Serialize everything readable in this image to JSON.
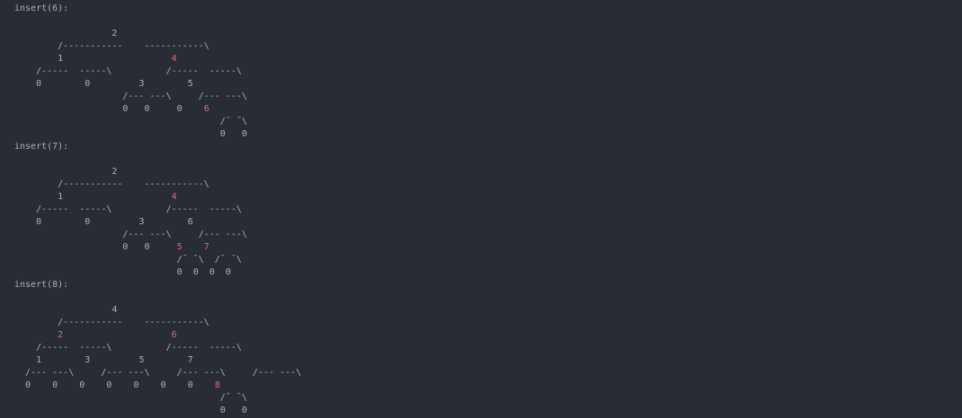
{
  "colors": {
    "background": "#282c34",
    "black_node": "#abb2bf",
    "red_node": "#e06c75",
    "edge": "#abb2bf"
  },
  "blocks": [
    {
      "header": "insert(6):",
      "rows": [
        [
          [
            "",
            "black"
          ]
        ],
        [
          [
            "                  ",
            "black"
          ],
          [
            "2",
            "black"
          ]
        ],
        [
          [
            "        /-----------    -----------\\",
            "edge"
          ]
        ],
        [
          [
            "        ",
            "black"
          ],
          [
            "1",
            "black"
          ],
          [
            "                    ",
            "black"
          ],
          [
            "4",
            "red"
          ]
        ],
        [
          [
            "    /-----  -----\\          /-----  -----\\",
            "edge"
          ]
        ],
        [
          [
            "    ",
            "black"
          ],
          [
            "0",
            "black"
          ],
          [
            "        ",
            "black"
          ],
          [
            "0",
            "black"
          ],
          [
            "         ",
            "black"
          ],
          [
            "3",
            "black"
          ],
          [
            "        ",
            "black"
          ],
          [
            "5",
            "black"
          ]
        ],
        [
          [
            "                    /--- ---\\     /--- ---\\",
            "edge"
          ]
        ],
        [
          [
            "                    ",
            "black"
          ],
          [
            "0",
            "black"
          ],
          [
            "   ",
            "black"
          ],
          [
            "0",
            "black"
          ],
          [
            "     ",
            "black"
          ],
          [
            "0",
            "black"
          ],
          [
            "    ",
            "black"
          ],
          [
            "6",
            "red"
          ]
        ],
        [
          [
            "                                      /¯ ¯\\",
            "edge"
          ]
        ],
        [
          [
            "                                      ",
            "black"
          ],
          [
            "0",
            "black"
          ],
          [
            "   ",
            "black"
          ],
          [
            "0",
            "black"
          ]
        ]
      ]
    },
    {
      "header": "insert(7):",
      "rows": [
        [
          [
            "",
            "black"
          ]
        ],
        [
          [
            "                  ",
            "black"
          ],
          [
            "2",
            "black"
          ]
        ],
        [
          [
            "        /-----------    -----------\\",
            "edge"
          ]
        ],
        [
          [
            "        ",
            "black"
          ],
          [
            "1",
            "black"
          ],
          [
            "                    ",
            "black"
          ],
          [
            "4",
            "red"
          ]
        ],
        [
          [
            "    /-----  -----\\          /-----  -----\\",
            "edge"
          ]
        ],
        [
          [
            "    ",
            "black"
          ],
          [
            "0",
            "black"
          ],
          [
            "        ",
            "black"
          ],
          [
            "0",
            "black"
          ],
          [
            "         ",
            "black"
          ],
          [
            "3",
            "black"
          ],
          [
            "        ",
            "black"
          ],
          [
            "6",
            "black"
          ]
        ],
        [
          [
            "                    /--- ---\\     /--- ---\\",
            "edge"
          ]
        ],
        [
          [
            "                    ",
            "black"
          ],
          [
            "0",
            "black"
          ],
          [
            "   ",
            "black"
          ],
          [
            "0",
            "black"
          ],
          [
            "     ",
            "black"
          ],
          [
            "5",
            "red"
          ],
          [
            "    ",
            "black"
          ],
          [
            "7",
            "red"
          ]
        ],
        [
          [
            "                              /¯ ¯\\  /¯ ¯\\",
            "edge"
          ]
        ],
        [
          [
            "                              ",
            "black"
          ],
          [
            "0",
            "black"
          ],
          [
            "  ",
            "black"
          ],
          [
            "0",
            "black"
          ],
          [
            "  ",
            "black"
          ],
          [
            "0",
            "black"
          ],
          [
            "  ",
            "black"
          ],
          [
            "0",
            "black"
          ]
        ]
      ]
    },
    {
      "header": "insert(8):",
      "rows": [
        [
          [
            "",
            "black"
          ]
        ],
        [
          [
            "                  ",
            "black"
          ],
          [
            "4",
            "black"
          ]
        ],
        [
          [
            "        /-----------    -----------\\",
            "edge"
          ]
        ],
        [
          [
            "        ",
            "black"
          ],
          [
            "2",
            "red"
          ],
          [
            "                    ",
            "black"
          ],
          [
            "6",
            "red"
          ]
        ],
        [
          [
            "    /-----  -----\\          /-----  -----\\",
            "edge"
          ]
        ],
        [
          [
            "    ",
            "black"
          ],
          [
            "1",
            "black"
          ],
          [
            "        ",
            "black"
          ],
          [
            "3",
            "black"
          ],
          [
            "         ",
            "black"
          ],
          [
            "5",
            "black"
          ],
          [
            "        ",
            "black"
          ],
          [
            "7",
            "black"
          ]
        ],
        [
          [
            "  /--- ---\\     /--- ---\\     /--- ---\\     /--- ---\\",
            "edge"
          ]
        ],
        [
          [
            "  ",
            "black"
          ],
          [
            "0",
            "black"
          ],
          [
            "    ",
            "black"
          ],
          [
            "0",
            "black"
          ],
          [
            "    ",
            "black"
          ],
          [
            "0",
            "black"
          ],
          [
            "    ",
            "black"
          ],
          [
            "0",
            "black"
          ],
          [
            "    ",
            "black"
          ],
          [
            "0",
            "black"
          ],
          [
            "    ",
            "black"
          ],
          [
            "0",
            "black"
          ],
          [
            "    ",
            "black"
          ],
          [
            "0",
            "black"
          ],
          [
            "    ",
            "black"
          ],
          [
            "8",
            "red"
          ]
        ],
        [
          [
            "                                      /¯ ¯\\",
            "edge"
          ]
        ],
        [
          [
            "                                      ",
            "black"
          ],
          [
            "0",
            "black"
          ],
          [
            "   ",
            "black"
          ],
          [
            "0",
            "black"
          ]
        ]
      ]
    }
  ]
}
